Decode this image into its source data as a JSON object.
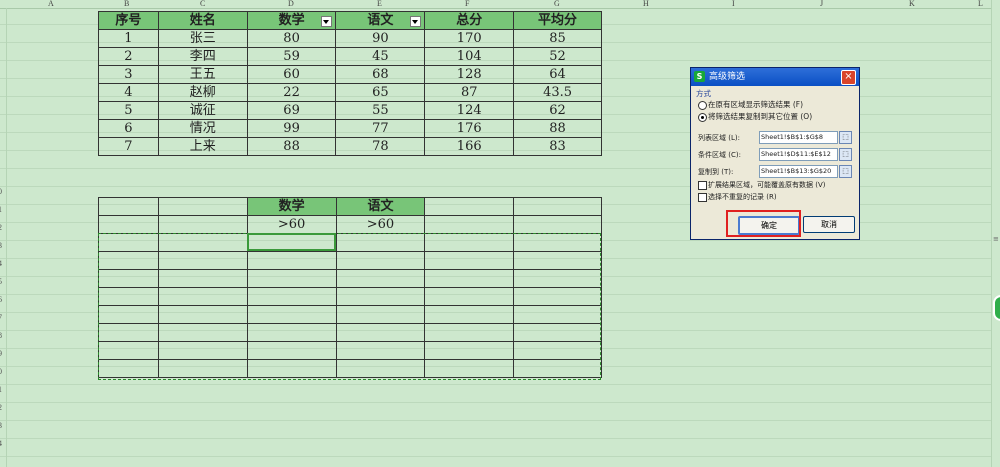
{
  "columns": [
    "A",
    "B",
    "C",
    "D",
    "E",
    "F",
    "G",
    "H",
    "I",
    "J",
    "K",
    "L"
  ],
  "rows": [
    "",
    "",
    "",
    "",
    "",
    "",
    "",
    "",
    "",
    "0",
    "1",
    "2",
    "3",
    "4",
    "5",
    "6",
    "7",
    "8",
    "9",
    "0",
    "1",
    "2",
    "3",
    "4"
  ],
  "table1": {
    "headers": [
      "序号",
      "姓名",
      "数学",
      "语文",
      "总分",
      "平均分"
    ],
    "rows": [
      [
        "1",
        "张三",
        "80",
        "90",
        "170",
        "85"
      ],
      [
        "2",
        "李四",
        "59",
        "45",
        "104",
        "52"
      ],
      [
        "3",
        "王五",
        "60",
        "68",
        "128",
        "64"
      ],
      [
        "4",
        "赵柳",
        "22",
        "65",
        "87",
        "43.5"
      ],
      [
        "5",
        "诚征",
        "69",
        "55",
        "124",
        "62"
      ],
      [
        "6",
        "情况",
        "99",
        "77",
        "176",
        "88"
      ],
      [
        "7",
        "上来",
        "88",
        "78",
        "166",
        "83"
      ]
    ]
  },
  "criteria": {
    "headers": [
      "",
      "",
      "数学",
      "语文",
      "",
      ""
    ],
    "values": [
      "",
      "",
      ">60",
      ">60",
      "",
      ""
    ]
  },
  "dialog": {
    "app_icon": "S",
    "title": "高级筛选",
    "close_icon": "×",
    "method_label": "方式",
    "option1": "在原有区域显示筛选结果 (F)",
    "option2": "将筛选结果复制到其它位置 (O)",
    "list_label": "列表区域 (L):",
    "list_value": "Sheet1!$B$1:$G$8",
    "criteria_label": "条件区域 (C):",
    "criteria_value": "Sheet1!$D$11:$E$12",
    "copyto_label": "复制到 (T):",
    "copyto_value": "Sheet1!$B$13:$G$20",
    "extend_label": "扩展结果区域，可能覆盖原有数据 (V)",
    "unique_label": "选择不重复的记录 (R)",
    "ok_label": "确定",
    "cancel_label": "取消"
  },
  "colors": {
    "sheet_bg": "#cde8cd",
    "header_fill": "#78c578",
    "highlight": "#e02020"
  }
}
